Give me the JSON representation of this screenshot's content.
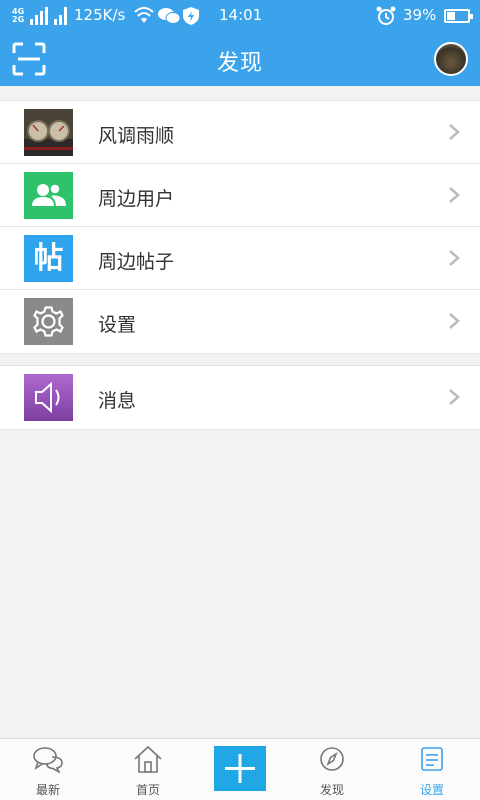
{
  "status_bar": {
    "network_top": "4G",
    "network_bottom": "2G",
    "speed": "125K/s",
    "time": "14:01",
    "battery": "39%"
  },
  "header": {
    "title": "发现"
  },
  "menu_group_1": [
    {
      "label": "风调雨顺",
      "icon": "dashboard-photo-icon"
    },
    {
      "label": "周边用户",
      "icon": "nearby-users-icon",
      "icon_color": "#2ec26a"
    },
    {
      "label": "周边帖子",
      "icon": "nearby-posts-icon",
      "icon_color": "#2fa3ee",
      "icon_text": "帖"
    },
    {
      "label": "设置",
      "icon": "gear-icon",
      "icon_color": "#8a8a8a"
    }
  ],
  "menu_group_2": [
    {
      "label": "消息",
      "icon": "speaker-icon",
      "icon_color": "#9b59b6"
    }
  ],
  "tabs": [
    {
      "label": "最新",
      "icon": "chat-bubbles-icon"
    },
    {
      "label": "首页",
      "icon": "home-icon"
    },
    {
      "label": "",
      "icon": "add-icon"
    },
    {
      "label": "发现",
      "icon": "discover-icon"
    },
    {
      "label": "设置",
      "icon": "settings-icon",
      "active": true
    }
  ],
  "colors": {
    "accent": "#3aa3ec",
    "background": "#f2f2f2"
  }
}
